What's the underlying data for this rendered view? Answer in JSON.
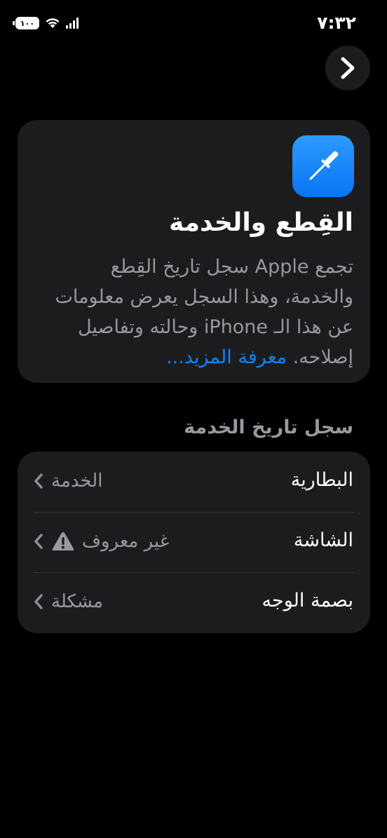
{
  "status_bar": {
    "time": "٧:٣٢",
    "battery": "١٠٠"
  },
  "card": {
    "title": "القِطع والخدمة",
    "description": "تجمع Apple سجل تاريخ القِطع والخدمة، وهذا السجل يعرض معلومات عن هذا الـ iPhone وحالته وتفاصيل إصلاحه.",
    "learn_more": "معرفة المزيد..."
  },
  "section": {
    "header": "سجل تاريخ الخدمة"
  },
  "rows": [
    {
      "label": "البطارية",
      "value": "الخدمة"
    },
    {
      "label": "الشاشة",
      "value": "غير معروف"
    },
    {
      "label": "بصمة الوجه",
      "value": "مشكلة"
    }
  ],
  "colors": {
    "background": "#000000",
    "card": "#1c1c1e",
    "secondary_text": "#98989f",
    "link": "#0a84ff",
    "icon_blue": "#0a84ff"
  },
  "icons": {
    "back": "chevron-right-icon",
    "app": "screwdriver-icon",
    "warning": "warning-triangle-icon",
    "row_chevron": "chevron-left-icon"
  }
}
